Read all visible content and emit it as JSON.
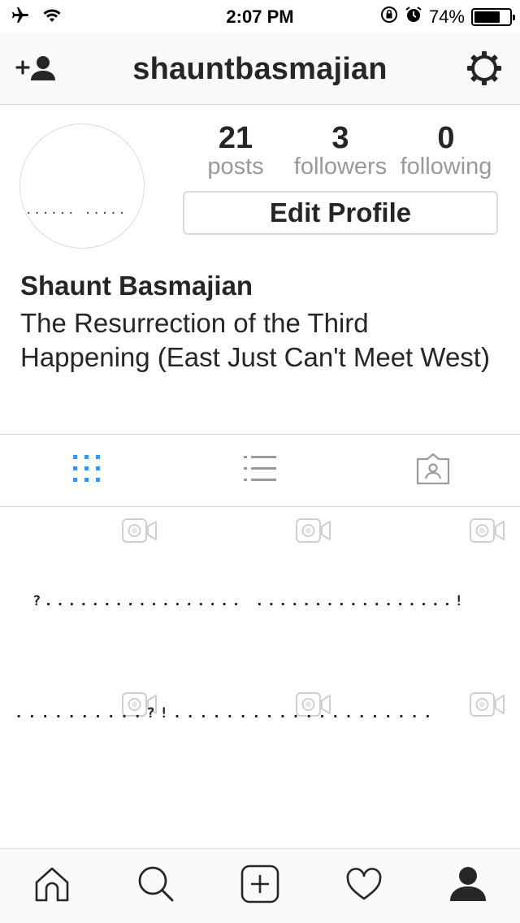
{
  "status_bar": {
    "time": "2:07 PM",
    "battery_percent": "74%",
    "battery_level": 0.74,
    "icons": [
      "airplane-icon",
      "wifi-icon",
      "orientation-lock-icon",
      "alarm-icon",
      "battery-icon"
    ]
  },
  "nav": {
    "title": "shauntbasmajian",
    "left_icon": "add-person-icon",
    "right_icon": "gear-icon"
  },
  "profile": {
    "avatar_text": "...... .....",
    "stats": [
      {
        "number": "21",
        "label": "posts"
      },
      {
        "number": "3",
        "label": "followers"
      },
      {
        "number": "0",
        "label": "following"
      }
    ],
    "edit_button": "Edit Profile",
    "name": "Shaunt Basmajian",
    "bio": "The Resurrection of the Third Happening (East Just Can't Meet West)"
  },
  "tabs": [
    {
      "icon": "grid-icon",
      "active": true,
      "color": "#3897f0"
    },
    {
      "icon": "list-icon",
      "active": false
    },
    {
      "icon": "tagged-photos-icon",
      "active": false
    }
  ],
  "grid": {
    "video_icon": "video-camera-icon",
    "line1": "?................. .................!",
    "line2": "..........?!...................."
  },
  "bottom_tabs": [
    "home-icon",
    "search-icon",
    "add-post-icon",
    "activity-heart-icon",
    "profile-icon"
  ],
  "colors": {
    "text": "#262626",
    "muted": "#999999",
    "border": "#dbdbdb",
    "accent": "#3897f0"
  }
}
